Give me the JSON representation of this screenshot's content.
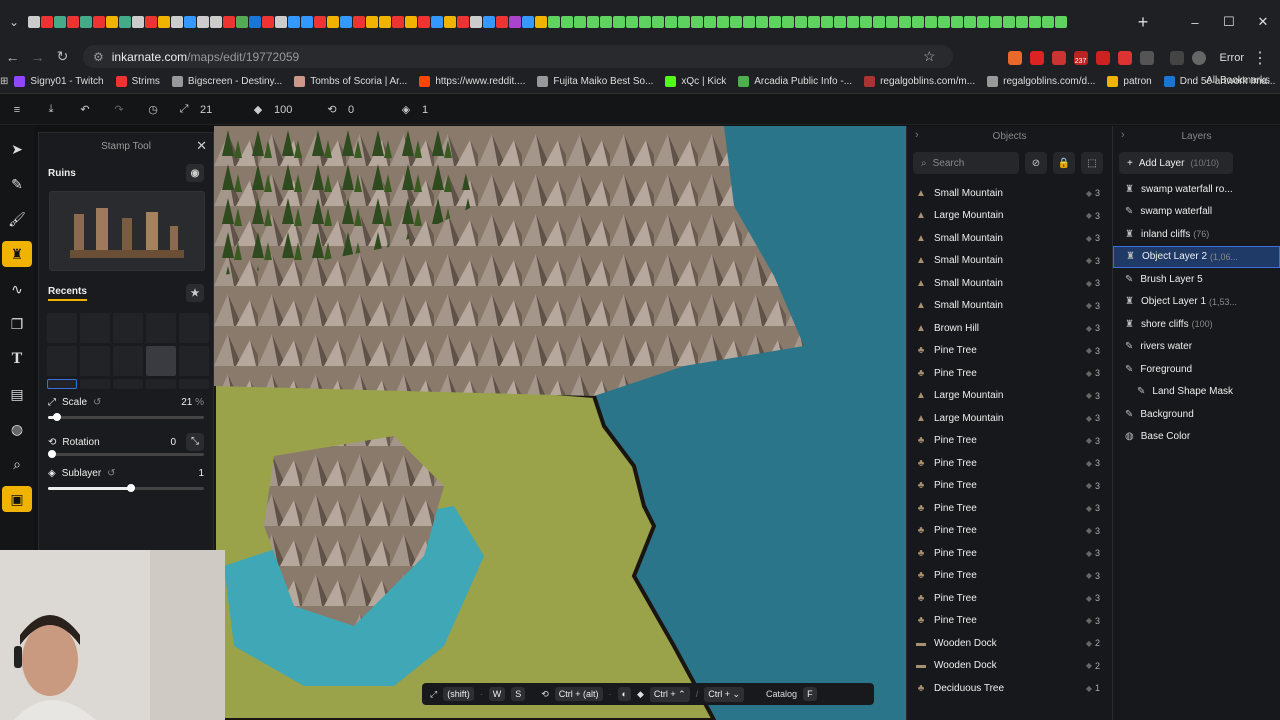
{
  "browser": {
    "url_host": "inkarnate.com",
    "url_path": "/maps/edit/19772059",
    "error_label": "Error",
    "all_bookmarks": "All Bookmarks",
    "bookmarks": [
      {
        "label": "Signy01 - Twitch",
        "color": "#9146ff"
      },
      {
        "label": "Strims",
        "color": "#e33"
      },
      {
        "label": "Bigscreen - Destiny...",
        "color": "#999"
      },
      {
        "label": "Tombs of Scoria | Ar...",
        "color": "#c98"
      },
      {
        "label": "https://www.reddit....",
        "color": "#ff4500"
      },
      {
        "label": "Fujita Maiko Best So...",
        "color": "#999"
      },
      {
        "label": "xQc | Kick",
        "color": "#53fc18"
      },
      {
        "label": "Arcadia Public Info -...",
        "color": "#4caf50"
      },
      {
        "label": "regalgoblins.com/m...",
        "color": "#a33"
      },
      {
        "label": "regalgoblins.com/d...",
        "color": "#999"
      },
      {
        "label": "patron",
        "color": "#f0b400"
      },
      {
        "label": "Dnd 5e artwork Ima...",
        "color": "#1976d2"
      }
    ],
    "ext_badge": "237"
  },
  "toolbar": {
    "size_value": "21",
    "opacity_value": "100",
    "rotation_value": "0",
    "layer_value": "1"
  },
  "stamp_panel": {
    "title": "Stamp Tool",
    "section_title": "Ruins",
    "recents_title": "Recents",
    "scale_label": "Scale",
    "scale_value": "21",
    "scale_unit": "%",
    "scale_fraction": 0.06,
    "rotation_label": "Rotation",
    "rotation_value": "0",
    "rotation_fraction": 0.0,
    "sublayer_label": "Sublayer",
    "sublayer_value": "1",
    "sublayer_fraction": 0.55
  },
  "objects_panel": {
    "title": "Objects",
    "search_placeholder": "Search",
    "items": [
      {
        "name": "Small Mountain",
        "count": "3"
      },
      {
        "name": "Large Mountain",
        "count": "3"
      },
      {
        "name": "Small Mountain",
        "count": "3"
      },
      {
        "name": "Small Mountain",
        "count": "3"
      },
      {
        "name": "Small Mountain",
        "count": "3"
      },
      {
        "name": "Small Mountain",
        "count": "3"
      },
      {
        "name": "Brown Hill",
        "count": "3"
      },
      {
        "name": "Pine Tree",
        "count": "3"
      },
      {
        "name": "Pine Tree",
        "count": "3"
      },
      {
        "name": "Large Mountain",
        "count": "3"
      },
      {
        "name": "Large Mountain",
        "count": "3"
      },
      {
        "name": "Pine Tree",
        "count": "3"
      },
      {
        "name": "Pine Tree",
        "count": "3"
      },
      {
        "name": "Pine Tree",
        "count": "3"
      },
      {
        "name": "Pine Tree",
        "count": "3"
      },
      {
        "name": "Pine Tree",
        "count": "3"
      },
      {
        "name": "Pine Tree",
        "count": "3"
      },
      {
        "name": "Pine Tree",
        "count": "3"
      },
      {
        "name": "Pine Tree",
        "count": "3"
      },
      {
        "name": "Pine Tree",
        "count": "3"
      },
      {
        "name": "Wooden Dock",
        "count": "2"
      },
      {
        "name": "Wooden Dock",
        "count": "2"
      },
      {
        "name": "Deciduous Tree",
        "count": "1"
      }
    ]
  },
  "layers_panel": {
    "title": "Layers",
    "add_label": "Add Layer",
    "add_count": "(10/10)",
    "items": [
      {
        "name": "swamp waterfall ro...",
        "count": ""
      },
      {
        "name": "swamp waterfall",
        "count": ""
      },
      {
        "name": "inland cliffs",
        "count": "(76)"
      },
      {
        "name": "Object Layer 2",
        "count": "(1,06..."
      },
      {
        "name": "Brush Layer 5",
        "count": ""
      },
      {
        "name": "Object Layer 1",
        "count": "(1,53..."
      },
      {
        "name": "shore cliffs",
        "count": "(100)"
      },
      {
        "name": "rivers water",
        "count": ""
      },
      {
        "name": "Foreground",
        "count": ""
      },
      {
        "name": "Land Shape Mask",
        "count": ""
      },
      {
        "name": "Background",
        "count": ""
      },
      {
        "name": "Base Color",
        "count": ""
      }
    ]
  },
  "bottom_bar": {
    "k1": "(shift)",
    "k2": "W",
    "k3": "S",
    "k4": "Ctrl + (alt)",
    "k5": "Ctrl +",
    "k6": "Ctrl +",
    "catalog": "Catalog",
    "catalog_key": "F"
  }
}
